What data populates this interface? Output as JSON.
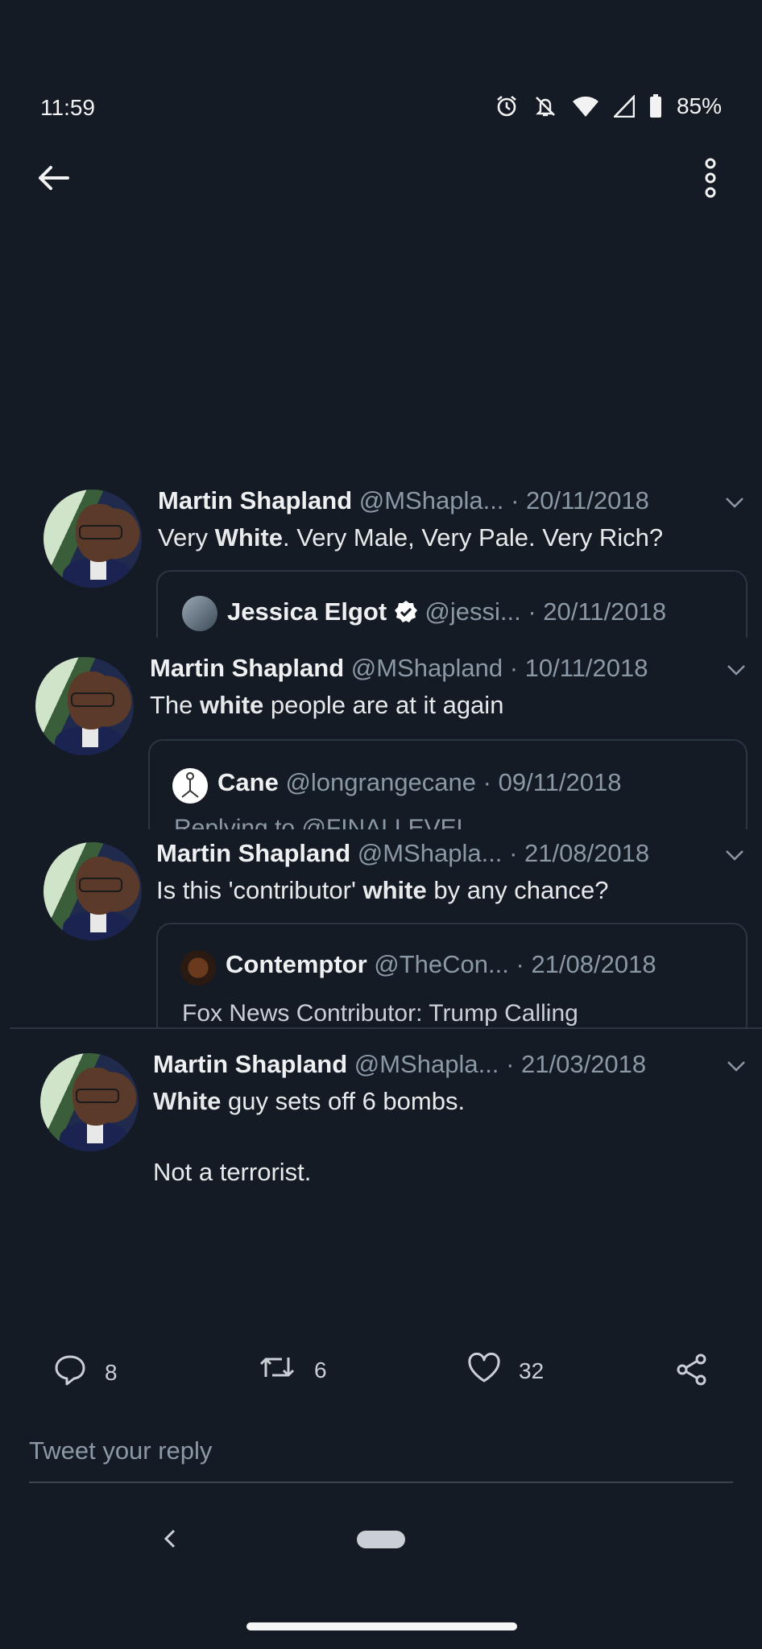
{
  "status_bar": {
    "time": "11:59",
    "battery": "85%"
  },
  "tweets": [
    {
      "name": "Martin Shapland",
      "handle": "@MShapla...",
      "date": "20/11/2018",
      "text": [
        {
          "t": "Very ",
          "b": false
        },
        {
          "t": "White",
          "b": true
        },
        {
          "t": ". Very Male, Very Pale. Very Rich?",
          "b": false
        }
      ],
      "quote": {
        "name": "Jessica Elgot",
        "verified": true,
        "handle": "@jessi...",
        "date": "20/11/2018",
        "sub": ""
      }
    },
    {
      "name": "Martin Shapland",
      "handle": "@MShapland",
      "date": "10/11/2018",
      "text": [
        {
          "t": "The ",
          "b": false
        },
        {
          "t": "white",
          "b": true
        },
        {
          "t": " people are at it again",
          "b": false
        }
      ],
      "quote": {
        "name": "Cane",
        "verified": false,
        "handle": "@longrangecane",
        "date": "09/11/2018",
        "sub": "Replying to @FINALLEVEL"
      }
    },
    {
      "name": "Martin Shapland",
      "handle": "@MShapla...",
      "date": "21/08/2018",
      "text": [
        {
          "t": "Is this 'contributor' ",
          "b": false
        },
        {
          "t": "white",
          "b": true
        },
        {
          "t": " by any chance?",
          "b": false
        }
      ],
      "quote": {
        "name": "Contemptor",
        "verified": false,
        "handle": "@TheCon...",
        "date": "21/08/2018",
        "sub": "Fox News Contributor: Trump Calling"
      }
    },
    {
      "name": "Martin Shapland",
      "handle": "@MShapla...",
      "date": "21/03/2018",
      "text": [
        {
          "t": "White",
          "b": true
        },
        {
          "t": " guy sets off 6 bombs.",
          "b": false
        }
      ],
      "text2": "Not a terrorist."
    }
  ],
  "actions": {
    "replies": "8",
    "retweets": "6",
    "likes": "32"
  },
  "reply": {
    "placeholder": "Tweet your reply"
  },
  "icons": {
    "back": "arrow-left-icon",
    "more": "more-vertical-icon",
    "reply": "reply-icon",
    "retweet": "retweet-icon",
    "like": "heart-icon",
    "share": "share-icon",
    "verified": "verified-badge-icon",
    "alarm": "alarm-icon",
    "mute": "bell-off-icon",
    "wifi": "wifi-icon",
    "signal": "signal-icon",
    "battery": "battery-icon"
  },
  "colors": {
    "background": "#141b25",
    "muted": "#8b98a5",
    "text": "#e7e9ea"
  }
}
